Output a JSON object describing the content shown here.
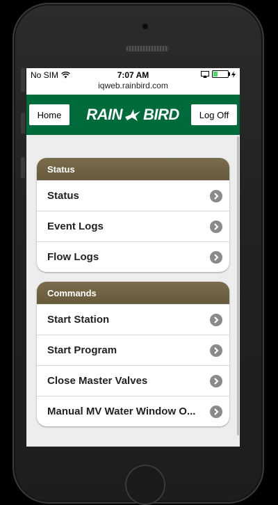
{
  "statusbar": {
    "carrier": "No SIM",
    "time": "7:07 AM"
  },
  "browser": {
    "url": "iqweb.rainbird.com"
  },
  "header": {
    "home_label": "Home",
    "logoff_label": "Log Off",
    "logo_text_left": "RAIN",
    "logo_text_right": "BIRD"
  },
  "status_group": {
    "title": "Status",
    "items": [
      {
        "label": "Status"
      },
      {
        "label": "Event Logs"
      },
      {
        "label": "Flow Logs"
      }
    ]
  },
  "commands_group": {
    "title": "Commands",
    "items": [
      {
        "label": "Start Station"
      },
      {
        "label": "Start Program"
      },
      {
        "label": "Close Master Valves"
      },
      {
        "label": "Manual MV Water Window O..."
      }
    ]
  },
  "colors": {
    "header_green": "#006b3a",
    "group_header": "#6f6344"
  },
  "icons": [
    "wifi-icon",
    "screen-mirror-icon",
    "battery-icon",
    "charging-icon",
    "chevron-right-icon",
    "bird-icon"
  ]
}
